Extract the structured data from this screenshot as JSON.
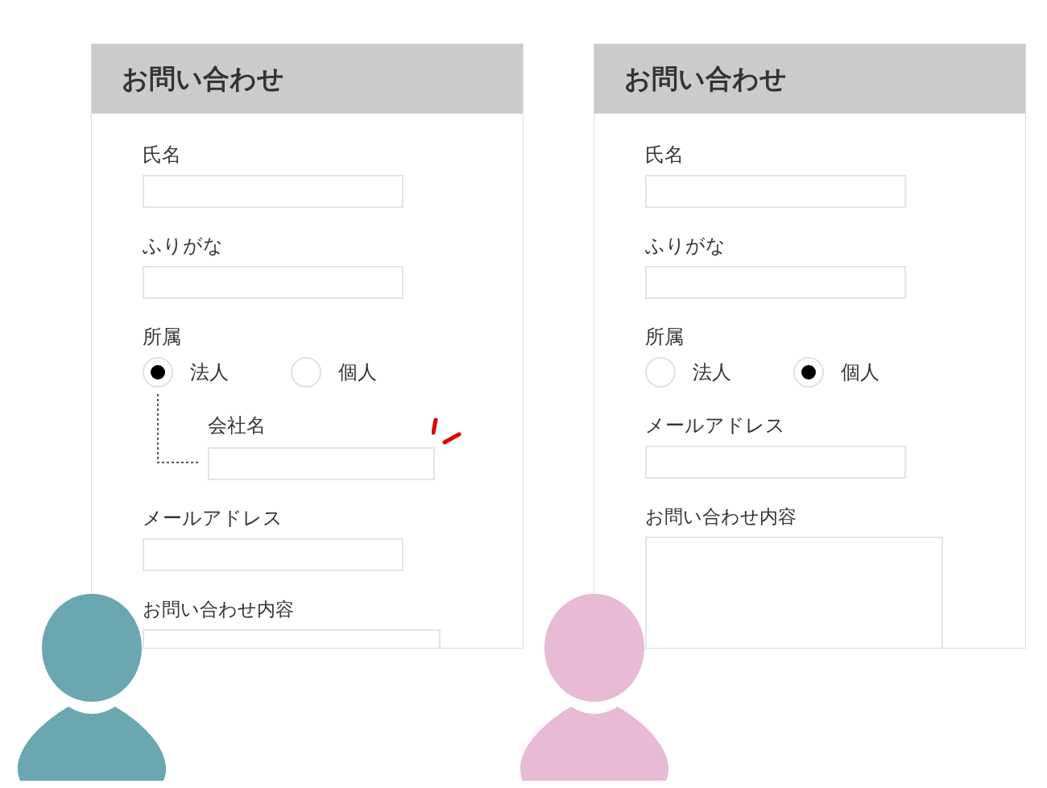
{
  "forms": [
    {
      "title": "お問い合わせ",
      "color": "#6aa7b0",
      "fields": [
        {
          "kind": "text",
          "label": "氏名"
        },
        {
          "kind": "text",
          "label": "ふりがな"
        },
        {
          "kind": "radio",
          "label": "所属",
          "options": [
            {
              "label": "法人",
              "selected": true
            },
            {
              "label": "個人",
              "selected": false
            }
          ]
        },
        {
          "kind": "subfield",
          "label": "会社名",
          "highlighted": true
        },
        {
          "kind": "text",
          "label": "メールアドレス"
        },
        {
          "kind": "textarea",
          "label": "お問い合わせ内容"
        }
      ]
    },
    {
      "title": "お問い合わせ",
      "color": "#e8bad6",
      "fields": [
        {
          "kind": "text",
          "label": "氏名"
        },
        {
          "kind": "text",
          "label": "ふりがな"
        },
        {
          "kind": "radio",
          "label": "所属",
          "options": [
            {
              "label": "法人",
              "selected": false
            },
            {
              "label": "個人",
              "selected": true
            }
          ]
        },
        {
          "kind": "text",
          "label": "メールアドレス"
        },
        {
          "kind": "textarea",
          "label": "お問い合わせ内容"
        }
      ]
    }
  ]
}
